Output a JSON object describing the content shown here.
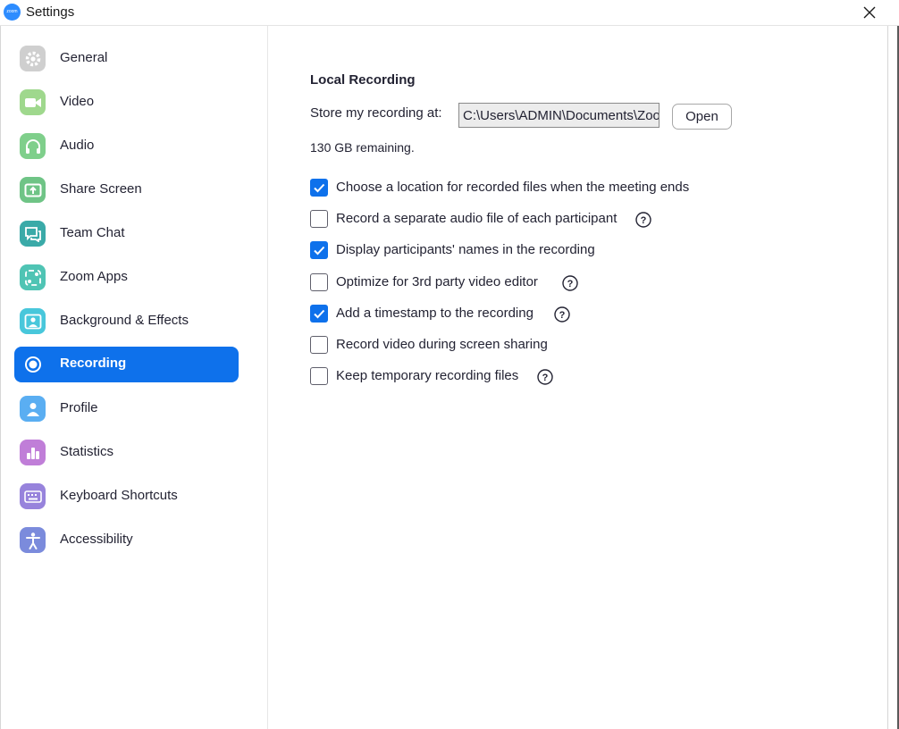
{
  "window": {
    "title": "Settings",
    "logo_text": "zoom"
  },
  "sidebar": {
    "items": [
      {
        "label": "General",
        "icon": "gear-icon",
        "color": "#b3b3b3"
      },
      {
        "label": "Video",
        "icon": "video-camera-icon",
        "color": "#7bc67b"
      },
      {
        "label": "Audio",
        "icon": "headphones-icon",
        "color": "#6cc17c"
      },
      {
        "label": "Share Screen",
        "icon": "share-screen-icon",
        "color": "#5fb97e"
      },
      {
        "label": "Team Chat",
        "icon": "chat-bubble-icon",
        "color": "#33a4a4"
      },
      {
        "label": "Zoom Apps",
        "icon": "apps-icon",
        "color": "#3dbfb1"
      },
      {
        "label": "Background & Effects",
        "icon": "background-portrait-icon",
        "color": "#3cc2d6"
      },
      {
        "label": "Recording",
        "icon": "record-icon",
        "color": "#0e71eb",
        "active": true
      },
      {
        "label": "Profile",
        "icon": "person-icon",
        "color": "#4aa3ef"
      },
      {
        "label": "Statistics",
        "icon": "bar-chart-icon",
        "color": "#b272d6"
      },
      {
        "label": "Keyboard Shortcuts",
        "icon": "keyboard-icon",
        "color": "#8a6fd8"
      },
      {
        "label": "Accessibility",
        "icon": "accessibility-icon",
        "color": "#6a7fd6"
      }
    ]
  },
  "recording": {
    "section_title": "Local Recording",
    "store_label": "Store my recording at:",
    "path_value": "C:\\Users\\ADMIN\\Documents\\Zoom",
    "open_button": "Open",
    "remaining": "130 GB remaining.",
    "options": [
      {
        "label": "Choose a location for recorded files when the meeting ends",
        "checked": true,
        "help": false
      },
      {
        "label": "Record a separate audio file of each participant",
        "checked": false,
        "help": true
      },
      {
        "label": "Display participants' names in the recording",
        "checked": true,
        "help": false
      },
      {
        "label": "Optimize for 3rd party video editor",
        "checked": false,
        "help": true
      },
      {
        "label": "Add a timestamp to the recording",
        "checked": true,
        "help": true
      },
      {
        "label": "Record video during screen sharing",
        "checked": false,
        "help": false
      },
      {
        "label": "Keep temporary recording files",
        "checked": false,
        "help": true
      }
    ]
  },
  "colors": {
    "accent": "#0e71eb",
    "text": "#232333"
  }
}
